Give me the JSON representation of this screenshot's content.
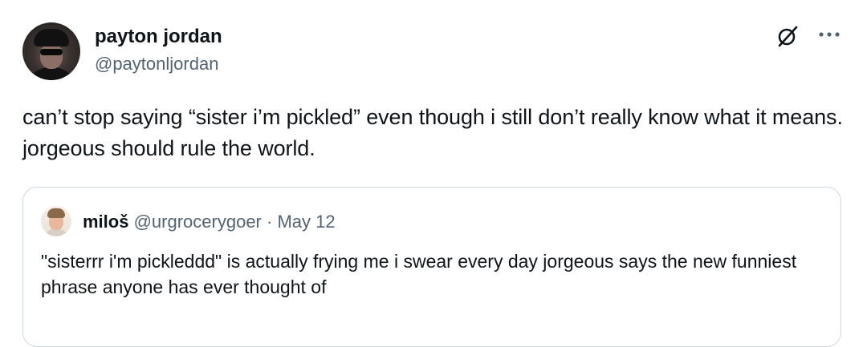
{
  "tweet": {
    "author": {
      "display_name": "payton jordan",
      "handle": "@paytonljordan",
      "avatar_icon": "profile-photo"
    },
    "icons": {
      "grok": "grok-icon",
      "more": "more-options-icon"
    },
    "text": "can’t stop saying “sister i’m pickled” even though i still don’t really know what it means. jorgeous should rule the world.",
    "quote": {
      "author": {
        "display_name": "miloš",
        "handle": "@urgrocerygoer",
        "separator": "·",
        "date": "May 12",
        "avatar_icon": "profile-photo"
      },
      "text": "\"sisterrr i'm pickleddd\" is actually frying me i swear every day jorgeous says the new funniest phrase anyone has ever thought of"
    }
  },
  "colors": {
    "text_primary": "#0f1419",
    "text_secondary": "#536471",
    "border": "#cfd9de",
    "background": "#ffffff"
  }
}
